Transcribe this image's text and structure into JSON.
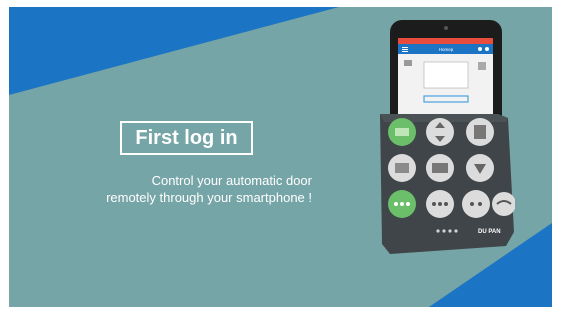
{
  "slide": {
    "title": "First log in",
    "subtitle_line1": "Control your automatic door",
    "subtitle_line2": "remotely through your smartphone !"
  },
  "phone": {
    "app_title": "Homep",
    "remote_brand": "DU PAN"
  },
  "colors": {
    "background_teal": "#76a5a7",
    "accent_blue": "#1b74c4",
    "phone_black": "#1c1c1c",
    "app_bar_red": "#e0392d",
    "remote_green": "#6bbf6a",
    "remote_body": "#3f4549"
  },
  "icons": [
    "menu-icon",
    "bluetooth-icon",
    "settings-icon",
    "door-mode-icon",
    "remote-button-icon"
  ]
}
